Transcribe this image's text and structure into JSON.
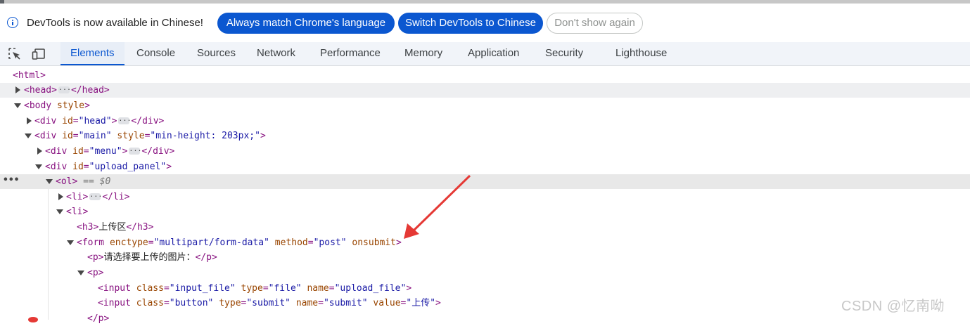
{
  "infobar": {
    "message": "DevTools is now available in Chinese!",
    "match_language": "Always match Chrome's language",
    "switch_language": "Switch DevTools to Chinese",
    "dismiss": "Don't show again",
    "icon": "info-icon"
  },
  "toolbar": {
    "inspect_icon": "inspect-element-icon",
    "device_icon": "device-toolbar-icon",
    "tabs": [
      "Elements",
      "Console",
      "Sources",
      "Network",
      "Performance",
      "Memory",
      "Application",
      "Security",
      "Lighthouse"
    ],
    "active_tab": "Elements"
  },
  "dom": {
    "l1": {
      "open": "<html>"
    },
    "l2": {
      "open": "<head>",
      "close": "</head>"
    },
    "l3": {
      "open": "<body",
      "attr": "style",
      "end": ">"
    },
    "l4": {
      "open": "<div",
      "attr": "id",
      "eq": "=",
      "val": "\"head\"",
      "end": ">",
      "close": "</div>"
    },
    "l5": {
      "open": "<div",
      "attr1": "id",
      "val1": "\"main\"",
      "attr2": "style",
      "val2": "\"min-height: 203px;\"",
      "end": ">"
    },
    "l6": {
      "open": "<div",
      "attr": "id",
      "val": "\"menu\"",
      "end": ">",
      "close": "</div>"
    },
    "l7": {
      "open": "<div",
      "attr": "id",
      "val": "\"upload_panel\"",
      "end": ">"
    },
    "l8": {
      "open": "<ol>",
      "marker": "== $0",
      "dots": "•••"
    },
    "l9": {
      "open": "<li>",
      "close": "</li>"
    },
    "l10": {
      "open": "<li>"
    },
    "l11": {
      "open": "<h3>",
      "text": "上传区",
      "close": "</h3>"
    },
    "l12": {
      "open": "<form",
      "attr1": "enctype",
      "val1": "\"multipart/form-data\"",
      "attr2": "method",
      "val2": "\"post\"",
      "attr3": "onsubmit",
      "end": ">"
    },
    "l13": {
      "open": "<p>",
      "text": "请选择要上传的图片：",
      "close": "</p>"
    },
    "l14": {
      "open": "<p>"
    },
    "l15": {
      "open": "<input",
      "attr1": "class",
      "val1": "\"input_file\"",
      "attr2": "type",
      "val2": "\"file\"",
      "attr3": "name",
      "val3": "\"upload_file\"",
      "end": ">"
    },
    "l16": {
      "open": "<input",
      "attr1": "class",
      "val1": "\"button\"",
      "attr2": "type",
      "val2": "\"submit\"",
      "attr3": "name",
      "val3": "\"submit\"",
      "attr4": "value",
      "val4": "\"上传\"",
      "end": ">"
    },
    "l17": {
      "close": "</p>"
    }
  },
  "watermark": "CSDN @忆南呦",
  "colors": {
    "accent": "#0b57d0",
    "tag": "#881280",
    "attr_name": "#994500",
    "attr_value": "#1a1aa6",
    "annotation_arrow": "#e53935"
  }
}
